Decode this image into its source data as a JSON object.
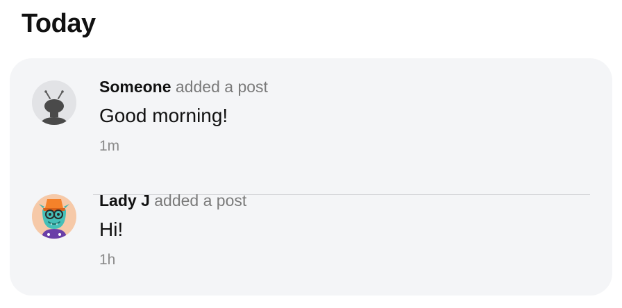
{
  "section": {
    "title": "Today"
  },
  "activity": [
    {
      "author": "Someone",
      "action": "added a post",
      "message": "Good morning!",
      "time": "1m",
      "avatar_icon": "default-alien-avatar"
    },
    {
      "author": "Lady J",
      "action": "added a post",
      "message": "Hi!",
      "time": "1h",
      "avatar_icon": "monster-avatar"
    }
  ],
  "colors": {
    "card_background": "#f4f5f7",
    "muted_text": "#7a7a7a",
    "divider": "#d4d5d8"
  }
}
